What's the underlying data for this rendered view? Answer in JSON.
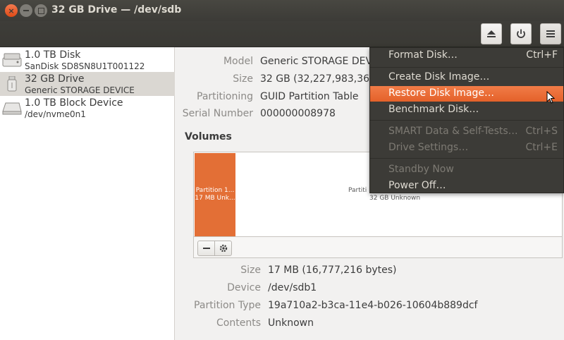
{
  "window": {
    "title": "32 GB Drive — /dev/sdb"
  },
  "icons": {
    "close": "close-icon",
    "minimize": "minimize-icon",
    "maximize": "maximize-icon",
    "eject": "eject-icon",
    "power": "power-icon",
    "menu": "hamburger-menu-icon",
    "minus": "minus-icon",
    "gear": "gear-icon"
  },
  "sidebar": {
    "drives": [
      {
        "name": "1.0 TB Disk",
        "subtitle": "SanDisk SD8SN8U1T001122",
        "icon": "hard-disk-icon"
      },
      {
        "name": "32 GB Drive",
        "subtitle": "Generic STORAGE DEVICE",
        "icon": "usb-drive-icon",
        "selected": true
      },
      {
        "name": "1.0 TB Block Device",
        "subtitle": "/dev/nvme0n1",
        "icon": "block-device-icon"
      }
    ]
  },
  "drive_info": {
    "model_label": "Model",
    "model_value": "Generic STORAGE DEV",
    "size_label": "Size",
    "size_value": "32 GB (32,227,983,360 b",
    "partitioning_label": "Partitioning",
    "partitioning_value": "GUID Partition Table",
    "serial_label": "Serial Number",
    "serial_value": "000000008978"
  },
  "volumes": {
    "title": "Volumes",
    "partitions": [
      {
        "line1": "Partition 1...",
        "line2": "17 MB Unk...",
        "color": "#e36f36"
      },
      {
        "line1": "Partiti",
        "line2": "32 GB Unknown",
        "color": "#ffffff"
      }
    ]
  },
  "partition_info": {
    "size_label": "Size",
    "size_value": "17 MB (16,777,216 bytes)",
    "device_label": "Device",
    "device_value": "/dev/sdb1",
    "type_label": "Partition Type",
    "type_value": "19a710a2-b3ca-11e4-b026-10604b889dcf",
    "contents_label": "Contents",
    "contents_value": "Unknown"
  },
  "menu": {
    "items": [
      {
        "label": "Format Disk…",
        "shortcut": "Ctrl+F",
        "enabled": true
      },
      {
        "label": "Create Disk Image…",
        "shortcut": "",
        "enabled": true
      },
      {
        "label": "Restore Disk Image…",
        "shortcut": "",
        "enabled": true,
        "highlighted": true
      },
      {
        "label": "Benchmark Disk…",
        "shortcut": "",
        "enabled": true
      },
      {
        "label": "SMART Data & Self-Tests…",
        "shortcut": "Ctrl+S",
        "enabled": false
      },
      {
        "label": "Drive Settings…",
        "shortcut": "Ctrl+E",
        "enabled": false
      },
      {
        "label": "Standby Now",
        "shortcut": "",
        "enabled": false
      },
      {
        "label": "Power Off…",
        "shortcut": "",
        "enabled": true
      }
    ]
  },
  "colors": {
    "accent": "#e4612a",
    "titlebar": "#3c3b37",
    "selection": "#dad7d2"
  }
}
